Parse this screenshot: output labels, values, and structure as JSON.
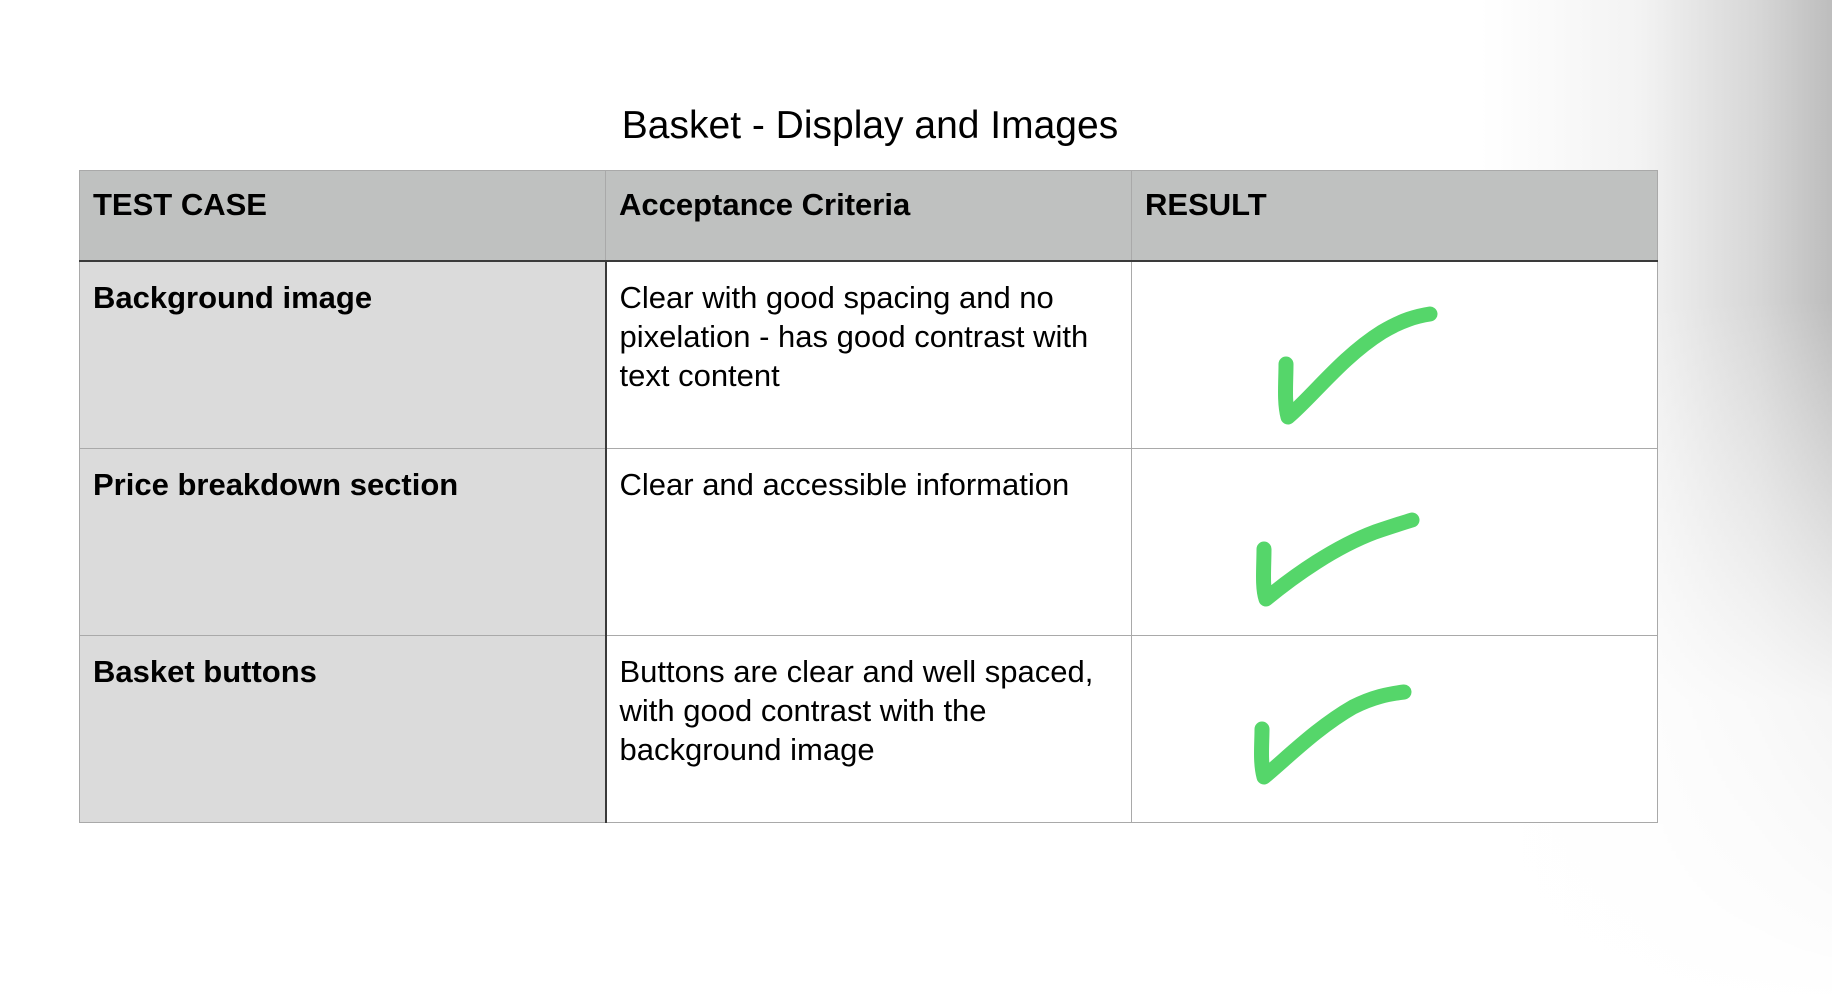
{
  "title": "Basket - Display and Images",
  "table": {
    "headers": [
      "TEST CASE",
      "Acceptance Criteria",
      "RESULT"
    ],
    "rows": [
      {
        "test_case": "Background image",
        "criteria": "Clear with good spacing and no pixelation - has good contrast with text content",
        "result_icon": "green-checkmark-icon"
      },
      {
        "test_case": "Price breakdown section",
        "criteria": "Clear and accessible information",
        "result_icon": "green-checkmark-icon"
      },
      {
        "test_case": "Basket buttons",
        "criteria": "Buttons are clear and well spaced, with good contrast with the background image",
        "result_icon": "green-checkmark-icon"
      }
    ]
  },
  "colors": {
    "header_bg": "#bfc1c0",
    "case_column_bg": "#dbdbdb",
    "check_color": "#55d66a"
  }
}
